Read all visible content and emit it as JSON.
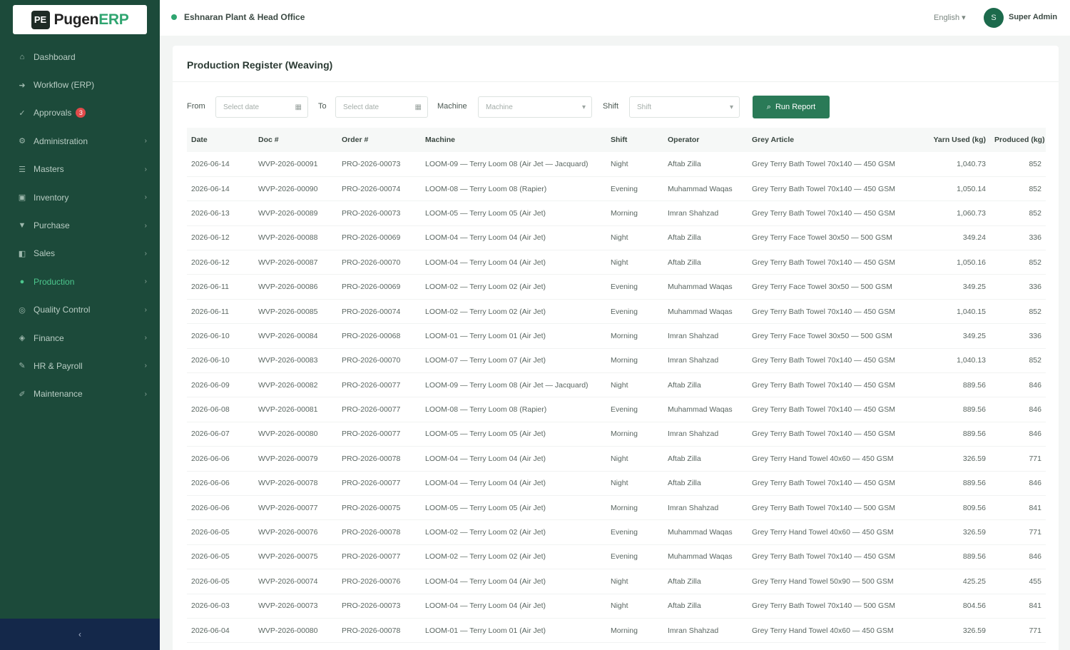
{
  "app": {
    "logo_mark": "PE",
    "logo_word": "Pugen",
    "logo_accent": "ERP",
    "accent_color": "#2fa570",
    "sidebar_color": "#1c4a3a"
  },
  "sidebar": {
    "items": [
      {
        "label": "Dashboard",
        "icon": "home-icon",
        "glyph": "⌂",
        "chevron": ""
      },
      {
        "label": "Workflow (ERP)",
        "icon": "workflow-icon",
        "glyph": "➜",
        "chevron": ""
      },
      {
        "label": "Approvals",
        "icon": "check-icon",
        "glyph": "✓",
        "chevron": "",
        "badge": "3"
      },
      {
        "label": "Administration",
        "icon": "admin-icon",
        "glyph": "⚙",
        "chevron": "›"
      },
      {
        "label": "Masters",
        "icon": "masters-icon",
        "glyph": "☰",
        "chevron": "›"
      },
      {
        "label": "Inventory",
        "icon": "inventory-icon",
        "glyph": "▣",
        "chevron": "›"
      },
      {
        "label": "Purchase",
        "icon": "purchase-icon",
        "glyph": "▼",
        "chevron": "›"
      },
      {
        "label": "Sales",
        "icon": "sales-icon",
        "glyph": "◧",
        "chevron": "›"
      },
      {
        "label": "Production",
        "icon": "production-icon",
        "glyph": "●",
        "chevron": "›",
        "active": true
      },
      {
        "label": "Quality Control",
        "icon": "quality-icon",
        "glyph": "◎",
        "chevron": "›"
      },
      {
        "label": "Finance",
        "icon": "finance-icon",
        "glyph": "◈",
        "chevron": "›"
      },
      {
        "label": "HR & Payroll",
        "icon": "hr-icon",
        "glyph": "✎",
        "chevron": "›"
      },
      {
        "label": "Maintenance",
        "icon": "wrench-icon",
        "glyph": "✐",
        "chevron": "›"
      }
    ],
    "collapse_label": "‹"
  },
  "topbar": {
    "breadcrumb": "Eshnaran Plant & Head Office",
    "language": "English ▾",
    "avatar_initial": "S",
    "user_name": "Super Admin"
  },
  "page": {
    "title": "Production Register (Weaving)"
  },
  "filters": {
    "from_label": "From",
    "from_placeholder": "Select date",
    "to_label": "To",
    "to_placeholder": "Select date",
    "machine_label": "Machine",
    "machine_placeholder": "Machine",
    "shift_label": "Shift",
    "shift_placeholder": "Shift",
    "run_label": "Run Report"
  },
  "table": {
    "columns": [
      "Date",
      "Doc #",
      "Order #",
      "Machine",
      "Shift",
      "Operator",
      "Grey Article",
      "Yarn Used (kg)",
      "Produced (kg)"
    ],
    "rows": [
      [
        "2026-06-14",
        "WVP-2026-00091",
        "PRO-2026-00073",
        "LOOM-09 — Terry Loom 08 (Air Jet — Jacquard)",
        "Night",
        "Aftab Zilla",
        "Grey Terry Bath Towel 70x140 — 450 GSM",
        "1,040.73",
        "852"
      ],
      [
        "2026-06-14",
        "WVP-2026-00090",
        "PRO-2026-00074",
        "LOOM-08 — Terry Loom 08 (Rapier)",
        "Evening",
        "Muhammad Waqas",
        "Grey Terry Bath Towel 70x140 — 450 GSM",
        "1,050.14",
        "852"
      ],
      [
        "2026-06-13",
        "WVP-2026-00089",
        "PRO-2026-00073",
        "LOOM-05 — Terry Loom 05 (Air Jet)",
        "Morning",
        "Imran Shahzad",
        "Grey Terry Bath Towel 70x140 — 450 GSM",
        "1,060.73",
        "852"
      ],
      [
        "2026-06-12",
        "WVP-2026-00088",
        "PRO-2026-00069",
        "LOOM-04 — Terry Loom 04 (Air Jet)",
        "Night",
        "Aftab Zilla",
        "Grey Terry Face Towel 30x50 — 500 GSM",
        "349.24",
        "336"
      ],
      [
        "2026-06-12",
        "WVP-2026-00087",
        "PRO-2026-00070",
        "LOOM-04 — Terry Loom 04 (Air Jet)",
        "Night",
        "Aftab Zilla",
        "Grey Terry Bath Towel 70x140 — 450 GSM",
        "1,050.16",
        "852"
      ],
      [
        "2026-06-11",
        "WVP-2026-00086",
        "PRO-2026-00069",
        "LOOM-02 — Terry Loom 02 (Air Jet)",
        "Evening",
        "Muhammad Waqas",
        "Grey Terry Face Towel 30x50 — 500 GSM",
        "349.25",
        "336"
      ],
      [
        "2026-06-11",
        "WVP-2026-00085",
        "PRO-2026-00074",
        "LOOM-02 — Terry Loom 02 (Air Jet)",
        "Evening",
        "Muhammad Waqas",
        "Grey Terry Bath Towel 70x140 — 450 GSM",
        "1,040.15",
        "852"
      ],
      [
        "2026-06-10",
        "WVP-2026-00084",
        "PRO-2026-00068",
        "LOOM-01 — Terry Loom 01 (Air Jet)",
        "Morning",
        "Imran Shahzad",
        "Grey Terry Face Towel 30x50 — 500 GSM",
        "349.25",
        "336"
      ],
      [
        "2026-06-10",
        "WVP-2026-00083",
        "PRO-2026-00070",
        "LOOM-07 — Terry Loom 07 (Air Jet)",
        "Morning",
        "Imran Shahzad",
        "Grey Terry Bath Towel 70x140 — 450 GSM",
        "1,040.13",
        "852"
      ],
      [
        "2026-06-09",
        "WVP-2026-00082",
        "PRO-2026-00077",
        "LOOM-09 — Terry Loom 08 (Air Jet — Jacquard)",
        "Night",
        "Aftab Zilla",
        "Grey Terry Bath Towel 70x140 — 450 GSM",
        "889.56",
        "846"
      ],
      [
        "2026-06-08",
        "WVP-2026-00081",
        "PRO-2026-00077",
        "LOOM-08 — Terry Loom 08 (Rapier)",
        "Evening",
        "Muhammad Waqas",
        "Grey Terry Bath Towel 70x140 — 450 GSM",
        "889.56",
        "846"
      ],
      [
        "2026-06-07",
        "WVP-2026-00080",
        "PRO-2026-00077",
        "LOOM-05 — Terry Loom 05 (Air Jet)",
        "Morning",
        "Imran Shahzad",
        "Grey Terry Bath Towel 70x140 — 450 GSM",
        "889.56",
        "846"
      ],
      [
        "2026-06-06",
        "WVP-2026-00079",
        "PRO-2026-00078",
        "LOOM-04 — Terry Loom 04 (Air Jet)",
        "Night",
        "Aftab Zilla",
        "Grey Terry Hand Towel 40x60 — 450 GSM",
        "326.59",
        "771"
      ],
      [
        "2026-06-06",
        "WVP-2026-00078",
        "PRO-2026-00077",
        "LOOM-04 — Terry Loom 04 (Air Jet)",
        "Night",
        "Aftab Zilla",
        "Grey Terry Bath Towel 70x140 — 450 GSM",
        "889.56",
        "846"
      ],
      [
        "2026-06-06",
        "WVP-2026-00077",
        "PRO-2026-00075",
        "LOOM-05 — Terry Loom 05 (Air Jet)",
        "Morning",
        "Imran Shahzad",
        "Grey Terry Bath Towel 70x140 — 500 GSM",
        "809.56",
        "841"
      ],
      [
        "2026-06-05",
        "WVP-2026-00076",
        "PRO-2026-00078",
        "LOOM-02 — Terry Loom 02 (Air Jet)",
        "Evening",
        "Muhammad Waqas",
        "Grey Terry Hand Towel 40x60 — 450 GSM",
        "326.59",
        "771"
      ],
      [
        "2026-06-05",
        "WVP-2026-00075",
        "PRO-2026-00077",
        "LOOM-02 — Terry Loom 02 (Air Jet)",
        "Evening",
        "Muhammad Waqas",
        "Grey Terry Bath Towel 70x140 — 450 GSM",
        "889.56",
        "846"
      ],
      [
        "2026-06-05",
        "WVP-2026-00074",
        "PRO-2026-00076",
        "LOOM-04 — Terry Loom 04 (Air Jet)",
        "Night",
        "Aftab Zilla",
        "Grey Terry Hand Towel 50x90 — 500 GSM",
        "425.25",
        "455"
      ],
      [
        "2026-06-03",
        "WVP-2026-00073",
        "PRO-2026-00073",
        "LOOM-04 — Terry Loom 04 (Air Jet)",
        "Night",
        "Aftab Zilla",
        "Grey Terry Bath Towel 70x140 — 500 GSM",
        "804.56",
        "841"
      ],
      [
        "2026-06-04",
        "WVP-2026-00080",
        "PRO-2026-00078",
        "LOOM-01 — Terry Loom 01 (Air Jet)",
        "Morning",
        "Imran Shahzad",
        "Grey Terry Hand Towel 40x60 — 450 GSM",
        "326.59",
        "771"
      ]
    ]
  }
}
